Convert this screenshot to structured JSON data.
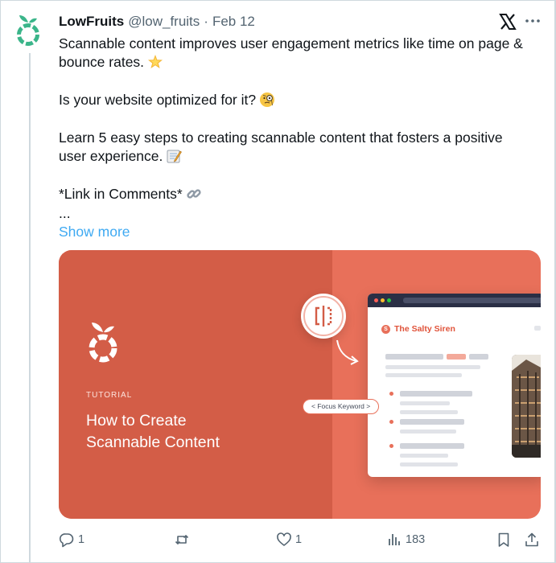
{
  "tweet": {
    "author_name": "LowFruits",
    "author_handle": "@low_fruits",
    "separator": "·",
    "date": "Feb 12",
    "lines": [
      "Scannable content improves user engagement metrics like time on page &",
      "bounce rates.",
      "Is your website optimized for it?",
      "Learn 5 easy steps to creating scannable content that fosters a positive",
      "user experience.",
      "*Link in Comments*",
      "..."
    ],
    "show_more": "Show more"
  },
  "card": {
    "eyebrow": "TUTORIAL",
    "title_line1": "How to Create",
    "title_line2": "Scannable Content",
    "brand_initial": "S",
    "brand_name": "The Salty Siren",
    "pill_text": "< Focus Keyword >"
  },
  "actions": {
    "replies": "1",
    "reposts": "",
    "likes": "1",
    "views": "183"
  },
  "icons": {
    "avatar": "lowfruits-logo",
    "platform": "x-logo",
    "more": "more-icon",
    "reply": "reply-icon",
    "repost": "repost-icon",
    "like": "heart-icon",
    "views": "views-icon",
    "bookmark": "bookmark-icon",
    "share": "share-icon"
  },
  "colors": {
    "brand_green": "#3bb58a",
    "card_left": "#d35d47",
    "card_right": "#e8705a",
    "link": "#1d9bf0",
    "muted": "#536471"
  }
}
